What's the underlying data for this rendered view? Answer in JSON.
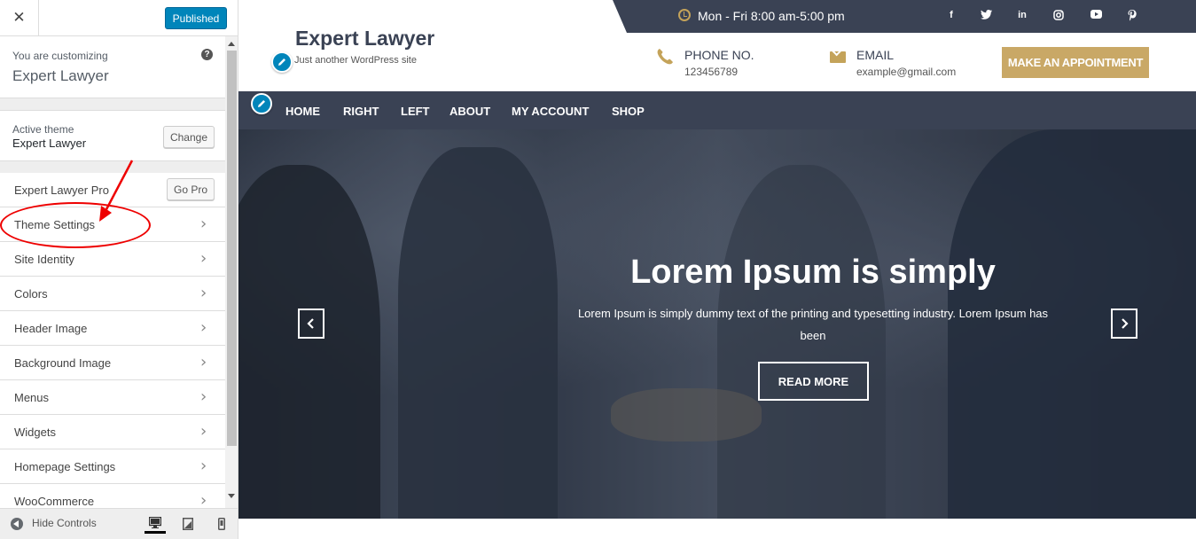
{
  "sidebar": {
    "close_glyph": "✕",
    "published_label": "Published",
    "customizing_label": "You are customizing",
    "site_name": "Expert Lawyer",
    "help_glyph": "?",
    "active_theme_label": "Active theme",
    "active_theme_name": "Expert Lawyer",
    "change_label": "Change",
    "pro_label": "Expert Lawyer Pro",
    "go_pro_label": "Go Pro",
    "sections": [
      {
        "label": "Theme Settings"
      },
      {
        "label": "Site Identity"
      },
      {
        "label": "Colors"
      },
      {
        "label": "Header Image"
      },
      {
        "label": "Background Image"
      },
      {
        "label": "Menus"
      },
      {
        "label": "Widgets"
      },
      {
        "label": "Homepage Settings"
      },
      {
        "label": "WooCommerce"
      }
    ],
    "chevron_glyph": "›",
    "hide_controls_label": "Hide Controls",
    "accent_color": "#0085ba"
  },
  "preview": {
    "hours": "Mon - Fri 8:00 am-5:00 pm",
    "social": [
      "f",
      "t",
      "in",
      "ig",
      "yt",
      "p"
    ],
    "site_title": "Expert Lawyer",
    "tagline": "Just another WordPress site",
    "phone_label": "PHONE NO.",
    "phone_value": "123456789",
    "email_label": "EMAIL",
    "email_value": "example@gmail.com",
    "appointment_label": "MAKE AN APPOINTMENT",
    "nav": [
      "HOME",
      "RIGHT",
      "LEFT",
      "ABOUT",
      "MY ACCOUNT",
      "SHOP"
    ],
    "hero_title": "Lorem Ipsum is simply",
    "hero_text": "Lorem Ipsum is simply dummy text of the printing and typesetting industry. Lorem Ipsum has been",
    "hero_button": "READ MORE",
    "primary_color": "#3a4254",
    "gold_color": "#c9a866"
  }
}
